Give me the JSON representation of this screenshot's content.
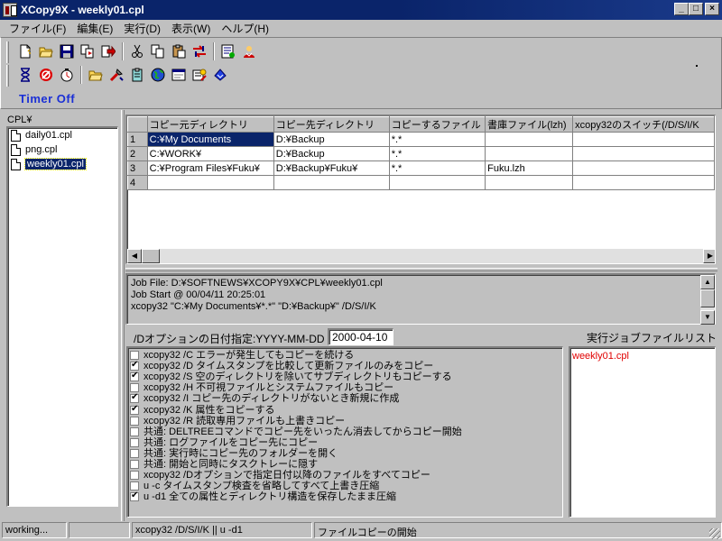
{
  "window": {
    "title": "XCopy9X - weekly01.cpl",
    "minimize": "_",
    "maximize": "□",
    "close": "×"
  },
  "menu": [
    {
      "label": "ファイル(F)"
    },
    {
      "label": "編集(E)"
    },
    {
      "label": "実行(D)"
    },
    {
      "label": "表示(W)"
    },
    {
      "label": "ヘルプ(H)"
    }
  ],
  "toolbar": {
    "row1_icons": [
      "new-file-icon",
      "open-folder-icon",
      "save-icon",
      "copy-files-icon",
      "exit-icon",
      "cut-icon",
      "copy-icon",
      "paste-icon",
      "swap-icon",
      "properties-icon",
      "help-icon"
    ],
    "row2_icons": [
      "hourglass-icon",
      "stop-icon",
      "timer-icon",
      "folder-open-icon",
      "tools-icon",
      "clipboard-icon",
      "globe-icon",
      "window-icon",
      "settings-icon",
      "diamond-icon"
    ],
    "timer_label": "Timer Off"
  },
  "sidebar": {
    "title": "CPL¥",
    "files": [
      {
        "name": "daily01.cpl",
        "selected": false
      },
      {
        "name": "png.cpl",
        "selected": false
      },
      {
        "name": "weekly01.cpl",
        "selected": true
      }
    ]
  },
  "grid": {
    "columns": [
      "コピー元ディレクトリ",
      "コピー先ディレクトリ",
      "コピーするファイル",
      "書庫ファイル(lzh)",
      "xcopy32のスイッチ(/D/S/I/K"
    ],
    "rows": [
      {
        "num": "1",
        "src": "C:¥My Documents",
        "dst": "D:¥Backup",
        "files": "*.*",
        "archive": ""
      },
      {
        "num": "2",
        "src": "C:¥WORK¥",
        "dst": "D:¥Backup",
        "files": "*.*",
        "archive": ""
      },
      {
        "num": "3",
        "src": "C:¥Program Files¥Fuku¥",
        "dst": "D:¥Backup¥Fuku¥",
        "files": "*.*",
        "archive": "Fuku.lzh"
      },
      {
        "num": "4",
        "src": "",
        "dst": "",
        "files": "",
        "archive": ""
      }
    ]
  },
  "log": {
    "lines": [
      "Job File: D:¥SOFTNEWS¥XCOPY9X¥CPL¥weekly01.cpl",
      "Job Start @ 00/04/11 20:25:01",
      "xcopy32 \"C:¥My Documents¥*.*\" \"D:¥Backup¥\" /D/S/I/K"
    ]
  },
  "date_option": {
    "label": "/Dオプションの日付指定:YYYY-MM-DD",
    "value": "2000-04-10"
  },
  "options": [
    {
      "label": "xcopy32 /C エラーが発生してもコピーを続ける",
      "checked": false
    },
    {
      "label": "xcopy32 /D タイムスタンプを比較して更新ファイルのみをコピー",
      "checked": true
    },
    {
      "label": "xcopy32 /S 空のディレクトリを除いてサブディレクトリもコピーする",
      "checked": true
    },
    {
      "label": "xcopy32 /H 不可視ファイルとシステムファイルもコピー",
      "checked": false
    },
    {
      "label": "xcopy32 /I コピー先のディレクトリがないとき新規に作成",
      "checked": true
    },
    {
      "label": "xcopy32 /K 属性をコピーする",
      "checked": true
    },
    {
      "label": "xcopy32 /R 読取専用ファイルも上書きコピー",
      "checked": false
    },
    {
      "label": "共通: DELTREEコマンドでコピー先をいったん消去してからコピー開始",
      "checked": false
    },
    {
      "label": "共通: ログファイルをコピー先にコピー",
      "checked": false
    },
    {
      "label": "共通: 実行時にコピー先のフォルダーを開く",
      "checked": false
    },
    {
      "label": "共通: 開始と同時にタスクトレーに隠す",
      "checked": false
    },
    {
      "label": "xcopy32 /Dオプションで指定日付以降のファイルをすべてコピー",
      "checked": false
    },
    {
      "label": "u -c タイムスタンプ検査を省略してすべて上書き圧縮",
      "checked": false
    },
    {
      "label": "u -d1 全ての属性とディレクトリ構造を保存したまま圧縮",
      "checked": true
    }
  ],
  "joblist": {
    "title": "実行ジョブファイルリスト",
    "items": [
      "weekly01.cpl"
    ]
  },
  "status": {
    "state": "working...",
    "empty": "",
    "command": "xcopy32 /D/S/I/K || u -d1",
    "message": "ファイルコピーの開始"
  }
}
